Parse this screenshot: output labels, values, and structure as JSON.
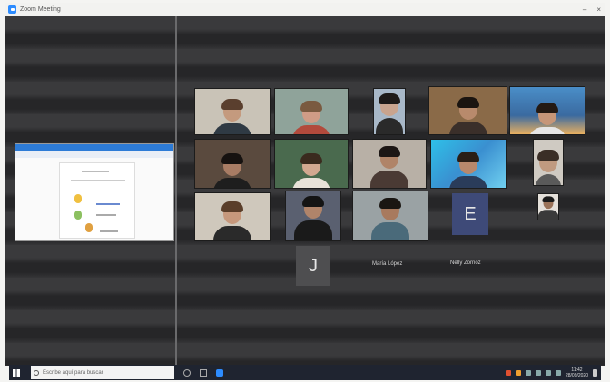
{
  "window": {
    "title": "Zoom Meeting",
    "controls": [
      "–",
      "×"
    ]
  },
  "gallery": {
    "avatars": [
      {
        "initial": "J"
      },
      {
        "initial": "E"
      }
    ],
    "names": [
      "María López",
      "Nelly Zornoz"
    ]
  },
  "taskbar": {
    "search_placeholder": "Escribe aquí para buscar",
    "clock_time": "11:42",
    "clock_date": "28/09/2020"
  },
  "colors": {
    "accent": "#2d8cff",
    "stage": "#2b2b2d",
    "taskbar": "#1f2430"
  }
}
